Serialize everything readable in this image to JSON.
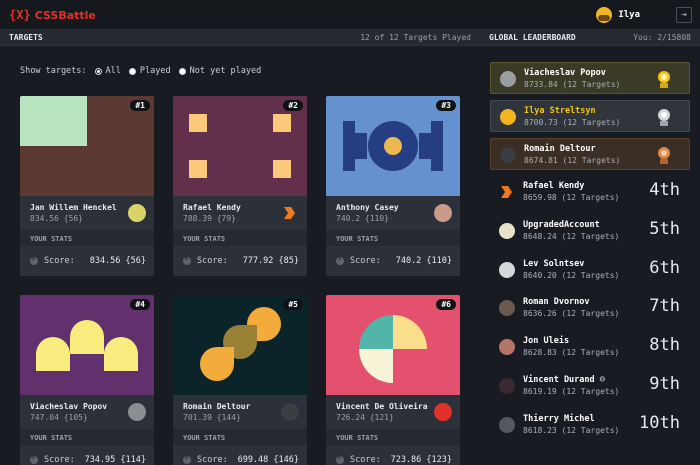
{
  "app": {
    "logo_mark": "{X}",
    "name": "CSSBattle"
  },
  "user": {
    "name": "Ilya",
    "logout_icon": "logout-icon"
  },
  "targets_header": {
    "title": "TARGETS",
    "count": "12 of 12 Targets Played"
  },
  "leaderboard_header": {
    "title": "GLOBAL LEADERBOARD",
    "you": "You: 2/15808"
  },
  "filter": {
    "label": "Show targets:",
    "options": [
      "All",
      "Played",
      "Not yet played"
    ],
    "selected": "All"
  },
  "cards": [
    {
      "num": "#1",
      "player": "Jan Willem Henckel",
      "score": "834.56 {56}",
      "your_stats": "YOUR STATS",
      "score_label": "Score:",
      "score_value": "834.56 {56}"
    },
    {
      "num": "#2",
      "player": "Rafael Kendy",
      "score": "788.39 {79}",
      "your_stats": "YOUR STATS",
      "score_label": "Score:",
      "score_value": "777.92 {85}"
    },
    {
      "num": "#3",
      "player": "Anthony Casey",
      "score": "740.2 {110}",
      "your_stats": "YOUR STATS",
      "score_label": "Score:",
      "score_value": "740.2 {110}"
    },
    {
      "num": "#4",
      "player": "Viacheslav Popov",
      "score": "747.04 {105}",
      "your_stats": "YOUR STATS",
      "score_label": "Score:",
      "score_value": "734.95 {114}"
    },
    {
      "num": "#5",
      "player": "Romain Deltour",
      "score": "701.39 {144}",
      "your_stats": "YOUR STATS",
      "score_label": "Score:",
      "score_value": "699.48 {146}"
    },
    {
      "num": "#6",
      "player": "Vincent De Oliveira",
      "score": "726.24 {121}",
      "your_stats": "YOUR STATS",
      "score_label": "Score:",
      "score_value": "723.86 {123}"
    }
  ],
  "leaderboard": [
    {
      "name": "Viacheslav Popov",
      "score": "8733.84 (12 Targets)",
      "rank": "",
      "medal": "gold-medal-icon"
    },
    {
      "name": "Ilya Streltsyn",
      "score": "8700.73 (12 Targets)",
      "rank": "",
      "medal": "silver-medal-icon"
    },
    {
      "name": "Romain Deltour",
      "score": "8674.81 (12 Targets)",
      "rank": "",
      "medal": "bronze-medal-icon"
    },
    {
      "name": "Rafael Kendy",
      "score": "8659.98 (12 Targets)",
      "rank": "4th"
    },
    {
      "name": "UpgradedAccount",
      "score": "8648.24 (12 Targets)",
      "rank": "5th"
    },
    {
      "name": "Lev Solntsev",
      "score": "8640.20 (12 Targets)",
      "rank": "6th"
    },
    {
      "name": "Roman Dvornov",
      "score": "8636.26 (12 Targets)",
      "rank": "7th"
    },
    {
      "name": "Jon Uleis",
      "score": "8628.83 (12 Targets)",
      "rank": "8th"
    },
    {
      "name": "Vincent Durand ☺",
      "score": "8619.19 (12 Targets)",
      "rank": "9th"
    },
    {
      "name": "Thierry Michel",
      "score": "8618.23 (12 Targets)",
      "rank": "10th"
    }
  ],
  "colors": {
    "accent": "#e0322a",
    "gold": "#f5c518",
    "bg": "#181c22",
    "panel": "#252a32"
  }
}
